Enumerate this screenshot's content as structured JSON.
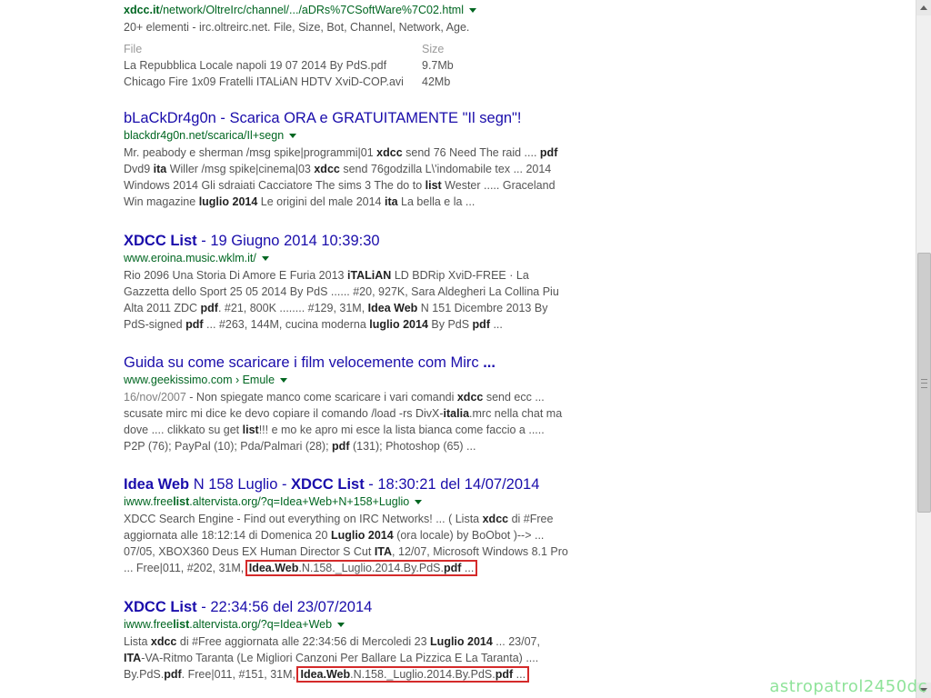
{
  "results": [
    {
      "url_parts": [
        [
          "b",
          "xdcc.it"
        ],
        [
          "t",
          "/network/OltreIrc/channel/.../aDRs%7CSoftWare%7C02.html"
        ]
      ],
      "snippet_lines": [
        [
          [
            "t",
            "20+ elementi - irc.oltreirc.net. File, Size, Bot, Channel, Network, Age."
          ]
        ]
      ],
      "table": {
        "headers": [
          "File",
          "Size"
        ],
        "rows": [
          [
            "La Repubblica Locale napoli 19 07 2014 By PdS.pdf",
            "9.7Mb"
          ],
          [
            "Chicago Fire 1x09 Fratelli ITALiAN HDTV XviD-COP.avi",
            "42Mb"
          ]
        ]
      }
    },
    {
      "title_parts": [
        [
          "t",
          "bLaCkDr4g0n - Scarica ORA e GRATUITAMENTE \"Il segn\"!"
        ]
      ],
      "url_parts": [
        [
          "t",
          "blackdr4g0n.net/scarica/Il+segn"
        ]
      ],
      "snippet_lines": [
        [
          [
            "t",
            "Mr. peabody e sherman /msg spike|programmi|01 "
          ],
          [
            "b",
            "xdcc"
          ],
          [
            "t",
            " send 76 Need The raid .... "
          ],
          [
            "b",
            "pdf"
          ]
        ],
        [
          [
            "t",
            "Dvd9 "
          ],
          [
            "b",
            "ita"
          ],
          [
            "t",
            " Willer /msg spike|cinema|03 "
          ],
          [
            "b",
            "xdcc"
          ],
          [
            "t",
            " send 76godzilla L\\'indomabile tex ... 2014"
          ]
        ],
        [
          [
            "t",
            "Windows 2014 Gli sdraiati Cacciatore The sims 3 The do to "
          ],
          [
            "b",
            "list"
          ],
          [
            "t",
            " Wester ..... Graceland"
          ]
        ],
        [
          [
            "t",
            "Win magazine "
          ],
          [
            "b",
            "luglio 2014"
          ],
          [
            "t",
            " Le origini del male 2014 "
          ],
          [
            "b",
            "ita"
          ],
          [
            "t",
            " La bella e la ..."
          ]
        ]
      ]
    },
    {
      "title_parts": [
        [
          "b",
          "XDCC List"
        ],
        [
          "t",
          " - 19 Giugno 2014 10:39:30"
        ]
      ],
      "url_parts": [
        [
          "t",
          "www.eroina.music.wklm.it/"
        ]
      ],
      "snippet_lines": [
        [
          [
            "t",
            "Rio 2096 Una Storia Di Amore E Furia 2013 "
          ],
          [
            "b",
            "iTALiAN"
          ],
          [
            "t",
            " LD BDRip XviD-FREE · La"
          ]
        ],
        [
          [
            "t",
            "Gazzetta dello Sport 25 05 2014 By PdS ...... #20, 927K, Sara Aldegheri La Collina Piu"
          ]
        ],
        [
          [
            "t",
            "Alta 2011 ZDC "
          ],
          [
            "b",
            "pdf"
          ],
          [
            "t",
            ". #21, 800K ........ #129, 31M, "
          ],
          [
            "b",
            "Idea Web"
          ],
          [
            "t",
            " N 151 Dicembre 2013 By"
          ]
        ],
        [
          [
            "t",
            "PdS-signed "
          ],
          [
            "b",
            "pdf"
          ],
          [
            "t",
            " ... #263, 144M, cucina moderna "
          ],
          [
            "b",
            "luglio 2014"
          ],
          [
            "t",
            " By PdS "
          ],
          [
            "b",
            "pdf"
          ],
          [
            "t",
            " ..."
          ]
        ]
      ]
    },
    {
      "title_parts": [
        [
          "t",
          "Guida su come scaricare i film velocemente com Mirc "
        ],
        [
          "b",
          "..."
        ]
      ],
      "url_parts": [
        [
          "t",
          "www.geekissimo.com › Emule"
        ]
      ],
      "snippet_lines": [
        [
          [
            "d",
            "16/nov/2007"
          ],
          [
            "t",
            " - Non spiegate manco come scaricare i vari comandi "
          ],
          [
            "b",
            "xdcc"
          ],
          [
            "t",
            " send ecc ..."
          ]
        ],
        [
          [
            "t",
            "scusate mirc mi dice ke devo copiare il comando /load -rs DivX-"
          ],
          [
            "b",
            "italia"
          ],
          [
            "t",
            ".mrc nella chat ma"
          ]
        ],
        [
          [
            "t",
            "dove .... clikkato su get "
          ],
          [
            "b",
            "list"
          ],
          [
            "t",
            "!!! e mo ke apro mi esce la lista bianca come faccio a ....."
          ]
        ],
        [
          [
            "t",
            "P2P (76); PayPal (10); Pda/Palmari (28); "
          ],
          [
            "b",
            "pdf"
          ],
          [
            "t",
            " (131); Photoshop (65) ..."
          ]
        ]
      ]
    },
    {
      "title_parts": [
        [
          "b",
          "Idea Web"
        ],
        [
          "t",
          " N 158 Luglio - "
        ],
        [
          "b",
          "XDCC List"
        ],
        [
          "t",
          " - 18:30:21 del 14/07/2014"
        ]
      ],
      "url_parts": [
        [
          "t",
          "iwww.free"
        ],
        [
          "b",
          "list"
        ],
        [
          "t",
          ".altervista.org/?q=Idea+Web+N+158+Luglio"
        ]
      ],
      "snippet_lines": [
        [
          [
            "t",
            "XDCC Search Engine - Find out everything on IRC Networks! ... ( Lista "
          ],
          [
            "b",
            "xdcc"
          ],
          [
            "t",
            " di #Free"
          ]
        ],
        [
          [
            "t",
            "aggiornata alle 18:12:14 di Domenica 20 "
          ],
          [
            "b",
            "Luglio 2014"
          ],
          [
            "t",
            " (ora locale) by BoObot )--> ..."
          ]
        ],
        [
          [
            "t",
            "07/05, XBOX360 Deus EX Human Director S Cut "
          ],
          [
            "b",
            "ITA"
          ],
          [
            "t",
            ", 12/07, Microsoft Windows 8.1 Pro"
          ]
        ],
        [
          [
            "t",
            "... Free|011, #202, 31M, "
          ],
          [
            "hs",
            ""
          ],
          [
            "b",
            "Idea.Web"
          ],
          [
            "t",
            ".N.158._Luglio.2014.By.PdS."
          ],
          [
            "b",
            "pdf"
          ],
          [
            "t",
            " ..."
          ],
          [
            "he",
            ""
          ]
        ]
      ]
    },
    {
      "title_parts": [
        [
          "b",
          "XDCC List"
        ],
        [
          "t",
          " - 22:34:56 del 23/07/2014"
        ]
      ],
      "url_parts": [
        [
          "t",
          "iwww.free"
        ],
        [
          "b",
          "list"
        ],
        [
          "t",
          ".altervista.org/?q=Idea+Web"
        ]
      ],
      "snippet_lines": [
        [
          [
            "t",
            "Lista "
          ],
          [
            "b",
            "xdcc"
          ],
          [
            "t",
            " di #Free aggiornata alle 22:34:56 di Mercoledi 23 "
          ],
          [
            "b",
            "Luglio 2014"
          ],
          [
            "t",
            " ... 23/07,"
          ]
        ],
        [
          [
            "b",
            "ITA"
          ],
          [
            "t",
            "-VA-Ritmo Taranta (Le Migliori Canzoni Per Ballare La Pizzica E La Taranta) ...."
          ]
        ],
        [
          [
            "t",
            "By.PdS."
          ],
          [
            "b",
            "pdf"
          ],
          [
            "t",
            ". Free|011, #151, 31M, "
          ],
          [
            "hs",
            ""
          ],
          [
            "b",
            "Idea.Web"
          ],
          [
            "t",
            ".N.158._Luglio.2014.By.PdS."
          ],
          [
            "b",
            "pdf"
          ],
          [
            "t",
            " ..."
          ],
          [
            "he",
            ""
          ]
        ]
      ]
    }
  ],
  "watermark": "astropatrol2450dc",
  "icons": {
    "scroll_up": "arrow-up-icon",
    "scroll_down": "arrow-down-icon",
    "caret": "caret-down-icon"
  },
  "colors": {
    "title": "#1a0dab",
    "url": "#006621",
    "snippet": "#545454",
    "highlight": "#d42a2a",
    "watermark": "#8fe39a"
  }
}
